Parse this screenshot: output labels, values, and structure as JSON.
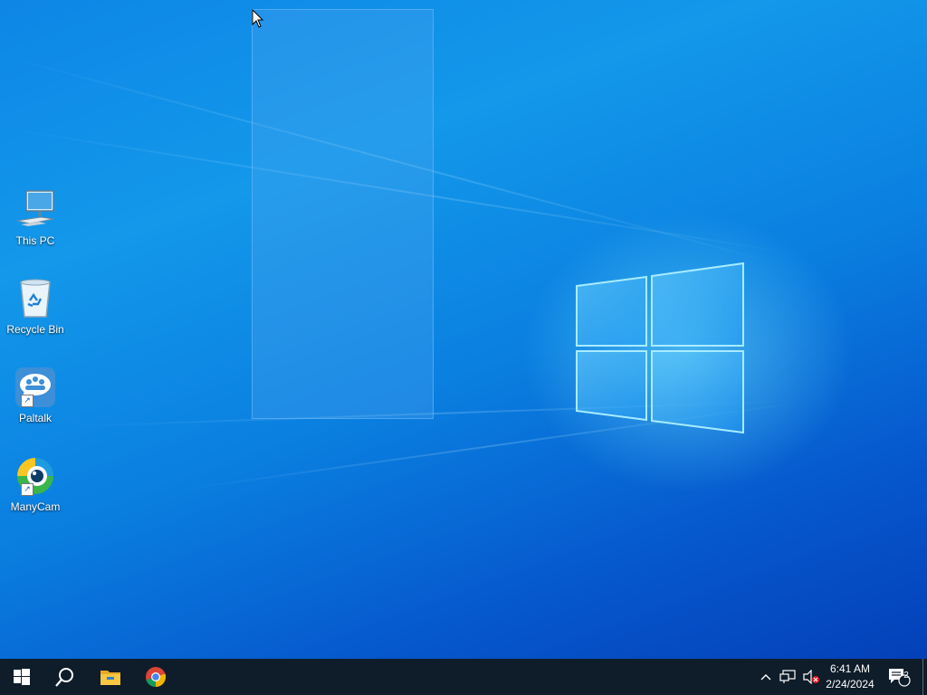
{
  "desktop": {
    "icons": [
      {
        "label": "This PC",
        "icon": "computer-icon"
      },
      {
        "label": "Recycle Bin",
        "icon": "recycle-bin-icon"
      },
      {
        "label": "Paltalk",
        "icon": "paltalk-icon",
        "shortcut": true
      },
      {
        "label": "ManyCam",
        "icon": "manycam-icon",
        "shortcut": true
      }
    ]
  },
  "taskbar": {
    "pinned": [
      "start-icon",
      "search-icon",
      "file-explorer-icon",
      "chrome-icon"
    ],
    "clock": {
      "time": "6:41 AM",
      "date": "2/24/2024"
    },
    "notifications": {
      "count": "2"
    }
  },
  "colors": {
    "taskbar": "#0f1d2a",
    "desktop_accent": "#0d86e6"
  }
}
